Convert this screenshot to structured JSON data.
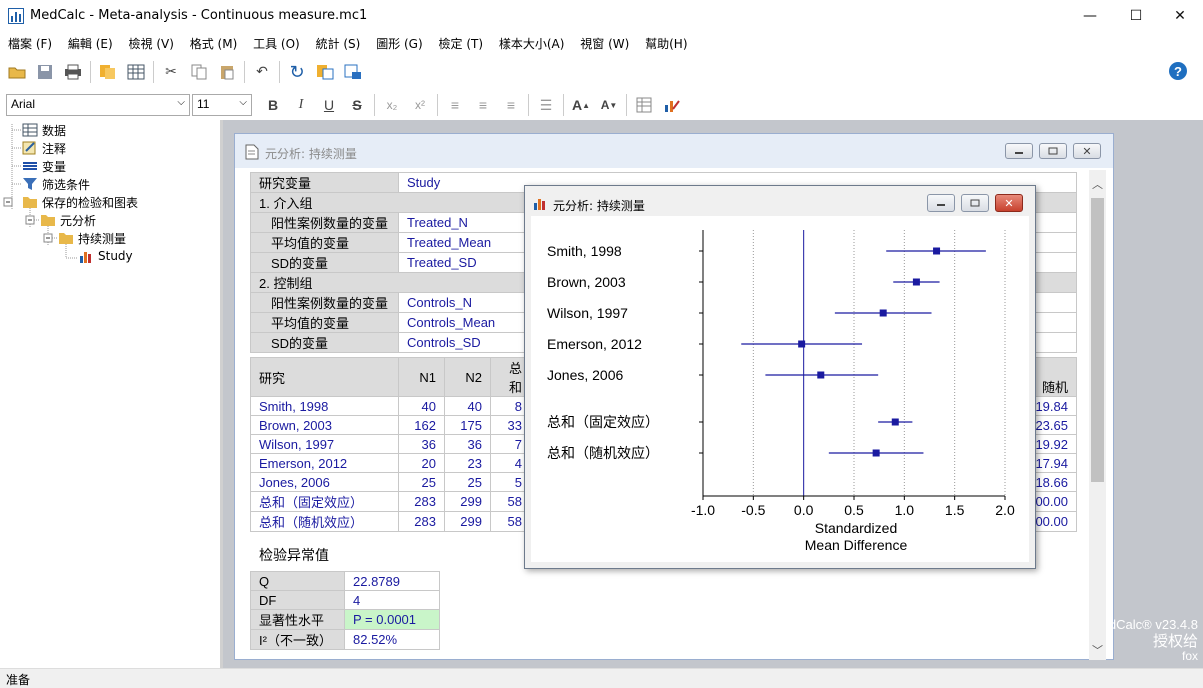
{
  "app": {
    "title": "MedCalc - Meta-analysis - Continuous measure.mc1"
  },
  "menu": [
    "檔案 (F)",
    "編輯 (E)",
    "檢視 (V)",
    "格式 (M)",
    "工具 (O)",
    "統計 (S)",
    "圖形 (G)",
    "檢定 (T)",
    "樣本大小(A)",
    "視窗 (W)",
    "幫助(H)"
  ],
  "format": {
    "font": "Arial",
    "size": "11"
  },
  "tree": {
    "items": [
      "数据",
      "注释",
      "变量",
      "筛选条件",
      "保存的检验和图表",
      "元分析",
      "持续测量",
      "Study"
    ]
  },
  "child": {
    "title": "元分析: 持续测量"
  },
  "params": {
    "study_label": "研究变量",
    "study_value": "Study",
    "group1": "1. 介入组",
    "g1": [
      {
        "k": "阳性案例数量的变量",
        "v": "Treated_N"
      },
      {
        "k": "平均值的变量",
        "v": "Treated_Mean"
      },
      {
        "k": "SD的变量",
        "v": "Treated_SD"
      }
    ],
    "group2": "2. 控制组",
    "g2": [
      {
        "k": "阳性案例数量的变量",
        "v": "Controls_N"
      },
      {
        "k": "平均值的变量",
        "v": "Controls_Mean"
      },
      {
        "k": "SD的变量",
        "v": "Controls_SD"
      }
    ]
  },
  "results": {
    "headers": {
      "study": "研究",
      "n1": "N1",
      "n2": "N2",
      "total": "总和",
      "random": "随机"
    },
    "rows": [
      {
        "name": "Smith, 1998",
        "n1": "40",
        "n2": "40",
        "total": "8",
        "random": "19.84"
      },
      {
        "name": "Brown, 2003",
        "n1": "162",
        "n2": "175",
        "total": "33",
        "random": "23.65"
      },
      {
        "name": "Wilson, 1997",
        "n1": "36",
        "n2": "36",
        "total": "7",
        "random": "19.92"
      },
      {
        "name": "Emerson, 2012",
        "n1": "20",
        "n2": "23",
        "total": "4",
        "random": "17.94"
      },
      {
        "name": "Jones, 2006",
        "n1": "25",
        "n2": "25",
        "total": "5",
        "random": "18.66"
      },
      {
        "name": "总和（固定效应）",
        "n1": "283",
        "n2": "299",
        "total": "58",
        "random": "00.00"
      },
      {
        "name": "总和（随机效应）",
        "n1": "283",
        "n2": "299",
        "total": "58",
        "random": "00.00"
      }
    ]
  },
  "hetero": {
    "title": "检验异常值",
    "rows": [
      {
        "k": "Q",
        "v": "22.8789"
      },
      {
        "k": "DF",
        "v": "4"
      },
      {
        "k": "显著性水平",
        "v": "P = 0.0001"
      },
      {
        "k": "I²（不一致）",
        "v": "82.52%"
      }
    ]
  },
  "float": {
    "title": "元分析: 持续测量"
  },
  "chart_data": {
    "type": "scatter",
    "categories": [
      "Smith, 1998",
      "Brown, 2003",
      "Wilson, 1997",
      "Emerson, 2012",
      "Jones, 2006",
      "总和（固定效应）",
      "总和（随机效应）"
    ],
    "estimates": [
      1.32,
      1.12,
      0.79,
      -0.02,
      0.17,
      0.91,
      0.72
    ],
    "ci_low": [
      0.82,
      0.89,
      0.31,
      -0.62,
      -0.38,
      0.74,
      0.25
    ],
    "ci_high": [
      1.81,
      1.35,
      1.27,
      0.58,
      0.74,
      1.08,
      1.19
    ],
    "xlim": [
      -1.0,
      2.0
    ],
    "xticks": [
      "-1.0",
      "-0.5",
      "0.0",
      "0.5",
      "1.0",
      "1.5",
      "2.0"
    ],
    "xlabel_line1": "Standardized",
    "xlabel_line2": "Mean Difference"
  },
  "watermark": {
    "line1": "dCalc® v23.4.8",
    "line2": "授权给",
    "line3": "fox"
  },
  "status": {
    "text": "准备"
  }
}
